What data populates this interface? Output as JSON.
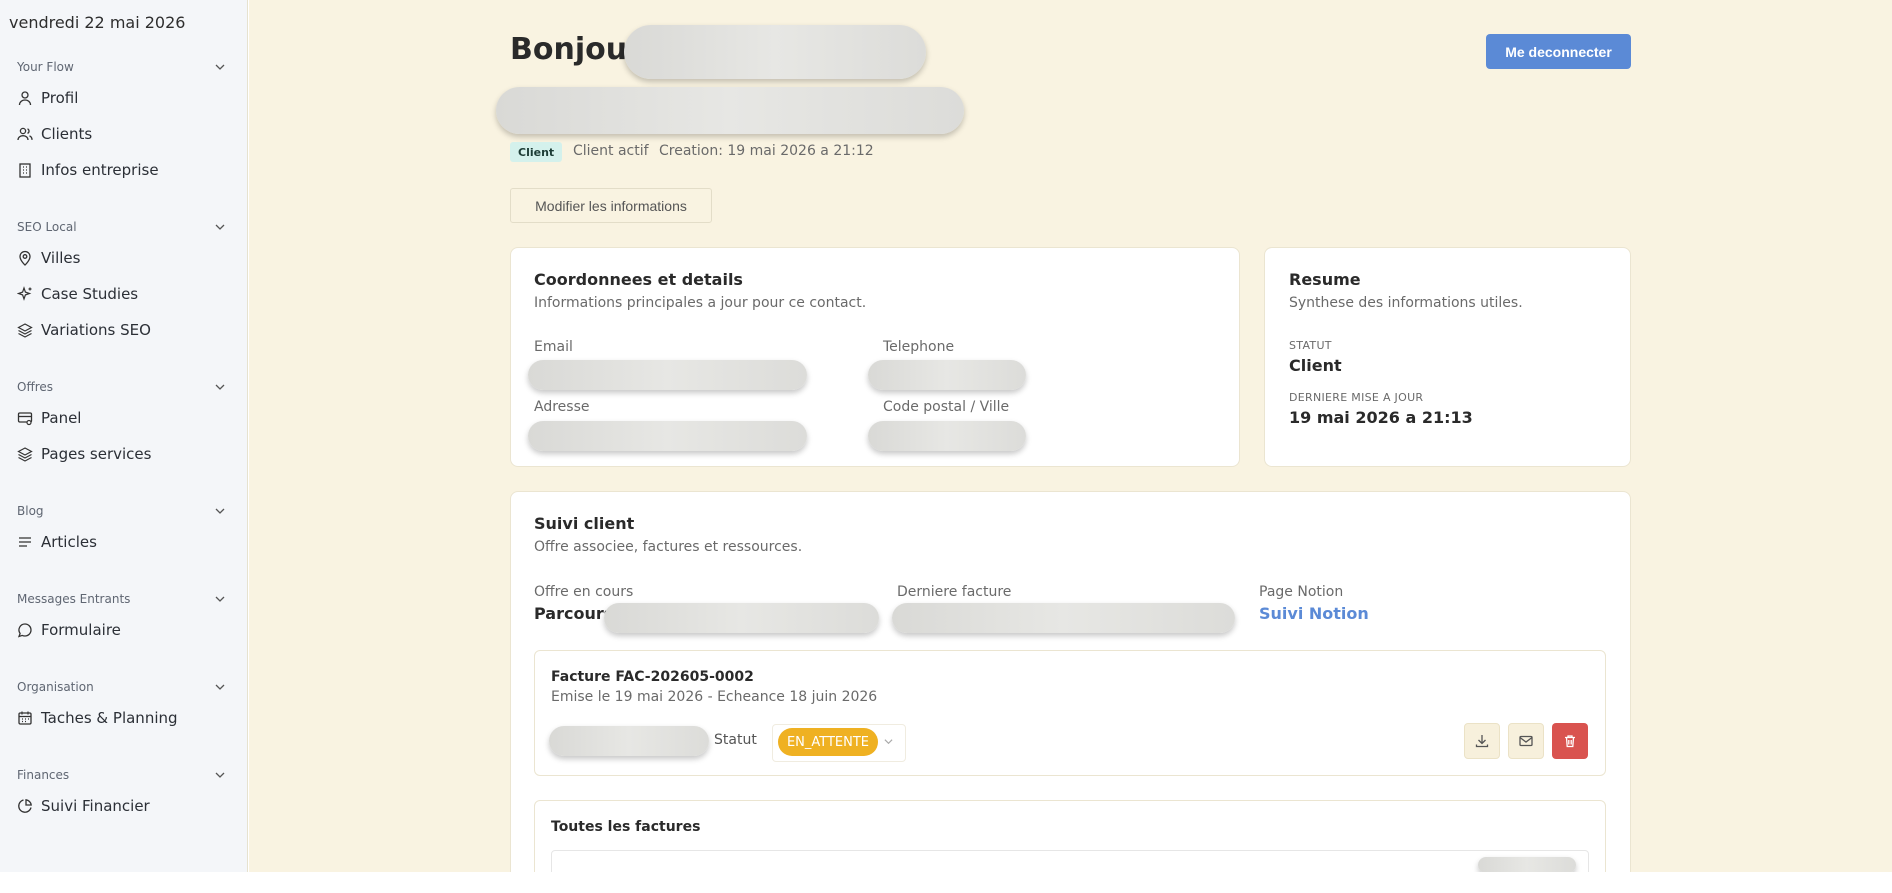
{
  "sidebar": {
    "date": "vendredi 22 mai 2026",
    "groups": [
      {
        "label": "Your Flow",
        "items": [
          {
            "label": "Profil",
            "icon": "user-icon"
          },
          {
            "label": "Clients",
            "icon": "users-icon"
          },
          {
            "label": "Infos entreprise",
            "icon": "building-icon"
          }
        ]
      },
      {
        "label": "SEO Local",
        "items": [
          {
            "label": "Villes",
            "icon": "map-pin-icon"
          },
          {
            "label": "Case Studies",
            "icon": "sparkles-icon"
          },
          {
            "label": "Variations SEO",
            "icon": "layers-icon"
          }
        ]
      },
      {
        "label": "Offres",
        "items": [
          {
            "label": "Panel",
            "icon": "panel-icon"
          },
          {
            "label": "Pages services",
            "icon": "layers-icon"
          }
        ]
      },
      {
        "label": "Blog",
        "items": [
          {
            "label": "Articles",
            "icon": "list-icon"
          }
        ]
      },
      {
        "label": "Messages Entrants",
        "items": [
          {
            "label": "Formulaire",
            "icon": "message-icon"
          }
        ]
      },
      {
        "label": "Organisation",
        "items": [
          {
            "label": "Taches & Planning",
            "icon": "calendar-icon"
          }
        ]
      },
      {
        "label": "Finances",
        "items": [
          {
            "label": "Suivi Financier",
            "icon": "pie-chart-icon"
          }
        ]
      }
    ]
  },
  "header": {
    "greeting": "Bonjour",
    "logout_label": "Me deconnecter",
    "badge": "Client",
    "status_text": "Client actif",
    "creation_text": "Creation: 19 mai 2026 a 21:12",
    "edit_label": "Modifier les informations"
  },
  "details": {
    "title": "Coordonnees et details",
    "subtitle": "Informations principales a jour pour ce contact.",
    "email_label": "Email",
    "phone_label": "Telephone",
    "address_label": "Adresse",
    "postal_label": "Code postal / Ville"
  },
  "summary": {
    "title": "Resume",
    "subtitle": "Synthese des informations utiles.",
    "status_label": "STATUT",
    "status_value": "Client",
    "updated_label": "DERNIERE MISE A JOUR",
    "updated_value": "19 mai 2026 a 21:13"
  },
  "followup": {
    "title": "Suivi client",
    "subtitle": "Offre associee, factures et ressources.",
    "offer_label": "Offre en cours",
    "offer_value": "Parcours",
    "last_invoice_label": "Derniere facture",
    "notion_label": "Page Notion",
    "notion_link": "Suivi Notion",
    "invoice": {
      "title": "Facture FAC-202605-0002",
      "dates": "Emise le 19 mai 2026 - Echeance 18 juin 2026",
      "status_label": "Statut",
      "status_value": "EN_ATTENTE"
    },
    "all_invoices_title": "Toutes les factures"
  },
  "colors": {
    "accent": "#5b8ad6",
    "background": "#f9f3e1",
    "status_pending": "#efb122",
    "danger": "#d9534f",
    "badge_bg": "#d4f1ec"
  }
}
